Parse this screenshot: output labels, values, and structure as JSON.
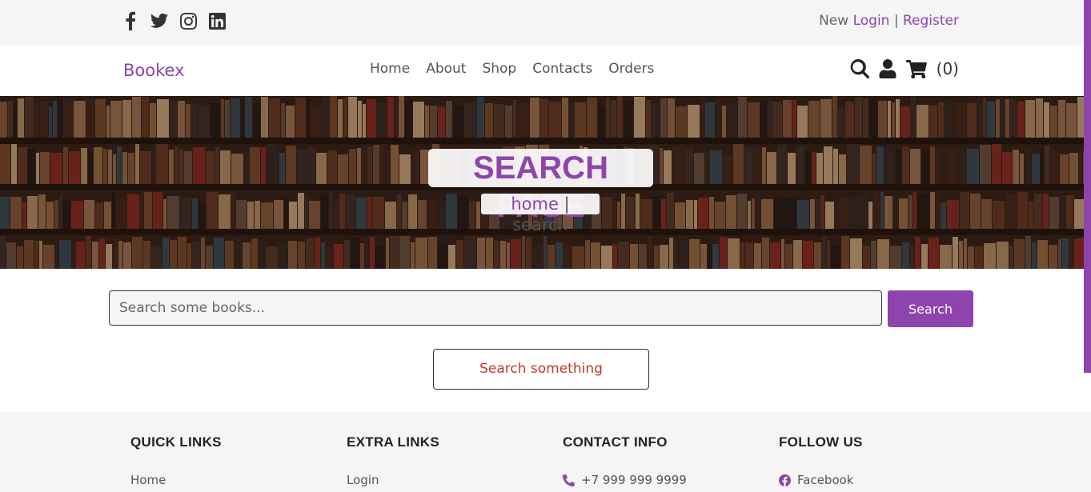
{
  "topbar": {
    "social_icons": [
      "facebook-icon",
      "twitter-icon",
      "instagram-icon",
      "linkedin-icon"
    ],
    "account": {
      "prefix": "New",
      "login": "Login",
      "separator": "|",
      "register": "Register"
    }
  },
  "navbar": {
    "logo": "Bookex",
    "links": [
      "Home",
      "About",
      "Shop",
      "Contacts",
      "Orders"
    ],
    "icons": [
      "search-icon",
      "user-icon",
      "cart-icon"
    ],
    "cart_count": "(0)"
  },
  "hero": {
    "title": "SEARCH PAGE",
    "crumb_home": "home",
    "crumb_separator": "|",
    "crumb_current": "search"
  },
  "search": {
    "placeholder": "Search some books...",
    "value": "",
    "button_label": "Search",
    "empty_message": "Search something"
  },
  "footer": {
    "columns": [
      {
        "title": "QUICK LINKS",
        "first_link": "Home"
      },
      {
        "title": "EXTRA LINKS",
        "first_link": "Login"
      },
      {
        "title": "CONTACT INFO",
        "first_link": "+7 999 999 9999",
        "icon": "phone-icon"
      },
      {
        "title": "FOLLOW US",
        "first_link": "Facebook",
        "icon": "facebook-icon"
      }
    ]
  },
  "colors": {
    "accent": "#8e44ad",
    "topbar_bg": "#f5f5f5",
    "empty_message": "#c0392b"
  }
}
